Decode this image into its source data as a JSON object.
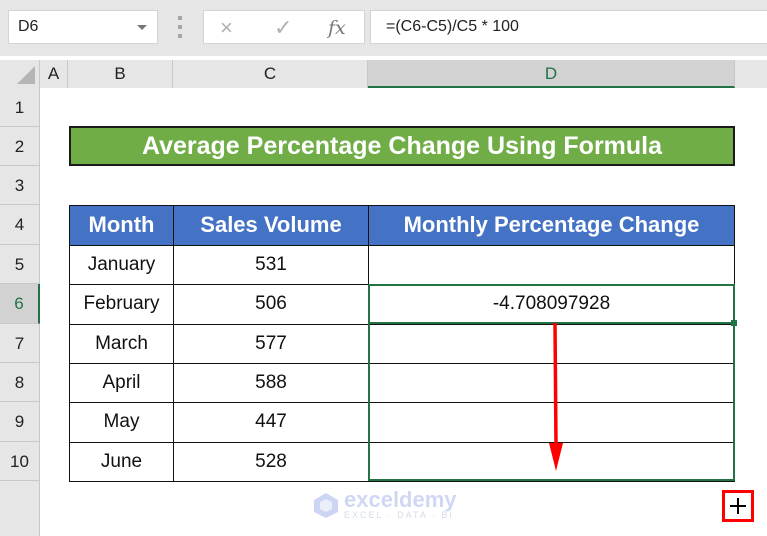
{
  "formula_bar": {
    "name_box": "D6",
    "formula": "=(C6-C5)/C5 * 100",
    "cancel_icon": "×",
    "enter_icon": "✓",
    "fx_label": "fx"
  },
  "columns": [
    "A",
    "B",
    "C",
    "D"
  ],
  "selected_column": "D",
  "rows": [
    "1",
    "2",
    "3",
    "4",
    "5",
    "6",
    "7",
    "8",
    "9",
    "10"
  ],
  "selected_row": "6",
  "sheet": {
    "title": "Average Percentage Change Using Formula",
    "headers": [
      "Month",
      "Sales Volume",
      "Monthly Percentage Change"
    ],
    "data": [
      {
        "month": "January",
        "sales": "531",
        "change": ""
      },
      {
        "month": "February",
        "sales": "506",
        "change": "-4.708097928"
      },
      {
        "month": "March",
        "sales": "577",
        "change": ""
      },
      {
        "month": "April",
        "sales": "588",
        "change": ""
      },
      {
        "month": "May",
        "sales": "447",
        "change": ""
      },
      {
        "month": "June",
        "sales": "528",
        "change": ""
      }
    ]
  },
  "colors": {
    "title_bg": "#70ad47",
    "header_bg": "#4472c4",
    "selection": "#217346",
    "annotation": "#ff0000"
  },
  "watermark": {
    "name": "exceldemy",
    "tagline": "EXCEL · DATA · BI"
  },
  "annotation": {
    "autofill_plus": "+"
  }
}
